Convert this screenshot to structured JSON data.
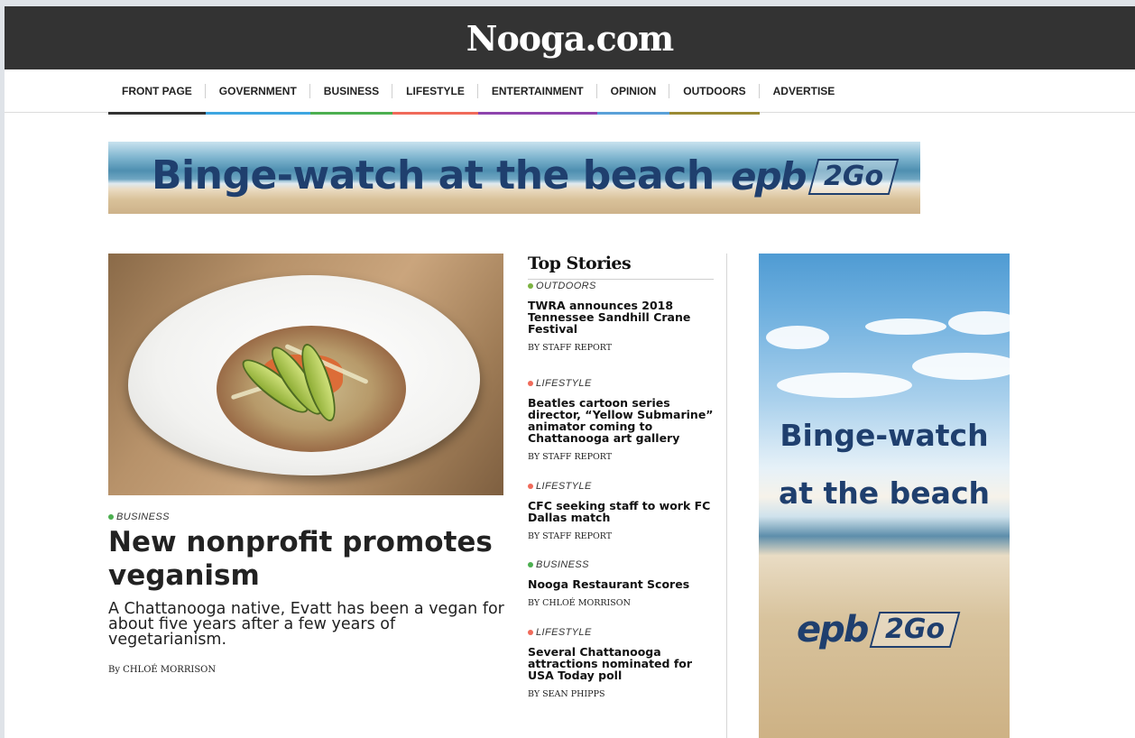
{
  "site": {
    "logo": "Nooga.com"
  },
  "nav": {
    "items": [
      {
        "label": "FRONT PAGE",
        "color": "#333333"
      },
      {
        "label": "GOVERNMENT",
        "color": "#3ea6e0"
      },
      {
        "label": "BUSINESS",
        "color": "#4caf50"
      },
      {
        "label": "LIFESTYLE",
        "color": "#f06a5a"
      },
      {
        "label": "ENTERTAINMENT",
        "color": "#8e44ad"
      },
      {
        "label": "OPINION",
        "color": "#5aa0d8"
      },
      {
        "label": "OUTDOORS",
        "color": "#9a8a34"
      },
      {
        "label": "ADVERTISE",
        "color": ""
      }
    ]
  },
  "banner_ad": {
    "headline": "Binge-watch at the beach",
    "brand": "epb",
    "brand_tag": "2Go"
  },
  "lead": {
    "category": "BUSINESS",
    "category_color": "#4caf50",
    "title": "New nonprofit promotes veganism",
    "summary": "A Chattanooga native, Evatt has been a vegan for about five years after a few years of vegetarianism.",
    "byline": "By CHLOÉ MORRISON",
    "image_icon": "vegan-bowl-photo"
  },
  "top_stories": {
    "heading": "Top Stories",
    "items": [
      {
        "category": "OUTDOORS",
        "color": "#7cb342",
        "title": "TWRA announces 2018 Tennessee Sandhill Crane Festival",
        "byline": "BY STAFF REPORT"
      },
      {
        "category": "LIFESTYLE",
        "color": "#f06a5a",
        "title": "Beatles cartoon series director, “Yellow Submarine” animator coming to Chattanooga art gallery",
        "byline": "BY STAFF REPORT"
      },
      {
        "category": "LIFESTYLE",
        "color": "#f06a5a",
        "title": "CFC seeking staff to work FC Dallas match",
        "byline": "BY STAFF REPORT"
      },
      {
        "category": "BUSINESS",
        "color": "#4caf50",
        "title": "Nooga Restaurant Scores",
        "byline": "BY CHLOÉ MORRISON"
      },
      {
        "category": "LIFESTYLE",
        "color": "#f06a5a",
        "title": "Several Chattanooga attractions nominated for USA Today poll",
        "byline": "BY SEAN PHIPPS"
      }
    ]
  },
  "side_ad": {
    "line1": "Binge-watch",
    "line2": "at the beach",
    "brand": "epb",
    "brand_tag": "2Go"
  }
}
